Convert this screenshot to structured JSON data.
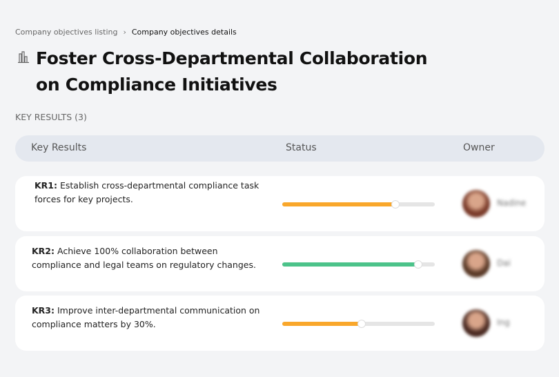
{
  "breadcrumb": {
    "parent": "Company objectives listing",
    "separator": "›",
    "current": "Company objectives details"
  },
  "objective": {
    "icon": "building-chart-icon",
    "title": "Foster Cross-Departmental Collaboration on Compliance Initiatives"
  },
  "key_results_label": "KEY RESULTS (3)",
  "table": {
    "headers": {
      "key_results": "Key Results",
      "status": "Status",
      "owner": "Owner"
    }
  },
  "rows": [
    {
      "id": "KR1:",
      "text": "Establish cross-departmental compliance task forces for key projects.",
      "progress": 74,
      "color": "#f9a72b",
      "owner": "Nadine",
      "avatar_color": "#7a3b2a"
    },
    {
      "id": "KR2:",
      "text": "Achieve 100% collaboration between compliance and legal teams on regulatory changes.",
      "progress": 89,
      "color": "#4cc38a",
      "owner": "Dai",
      "avatar_color": "#5a3a28"
    },
    {
      "id": "KR3:",
      "text": "Improve inter-departmental communication on compliance matters by 30%.",
      "progress": 52,
      "color": "#f9a72b",
      "owner": "Ing",
      "avatar_color": "#4a2a22"
    }
  ]
}
